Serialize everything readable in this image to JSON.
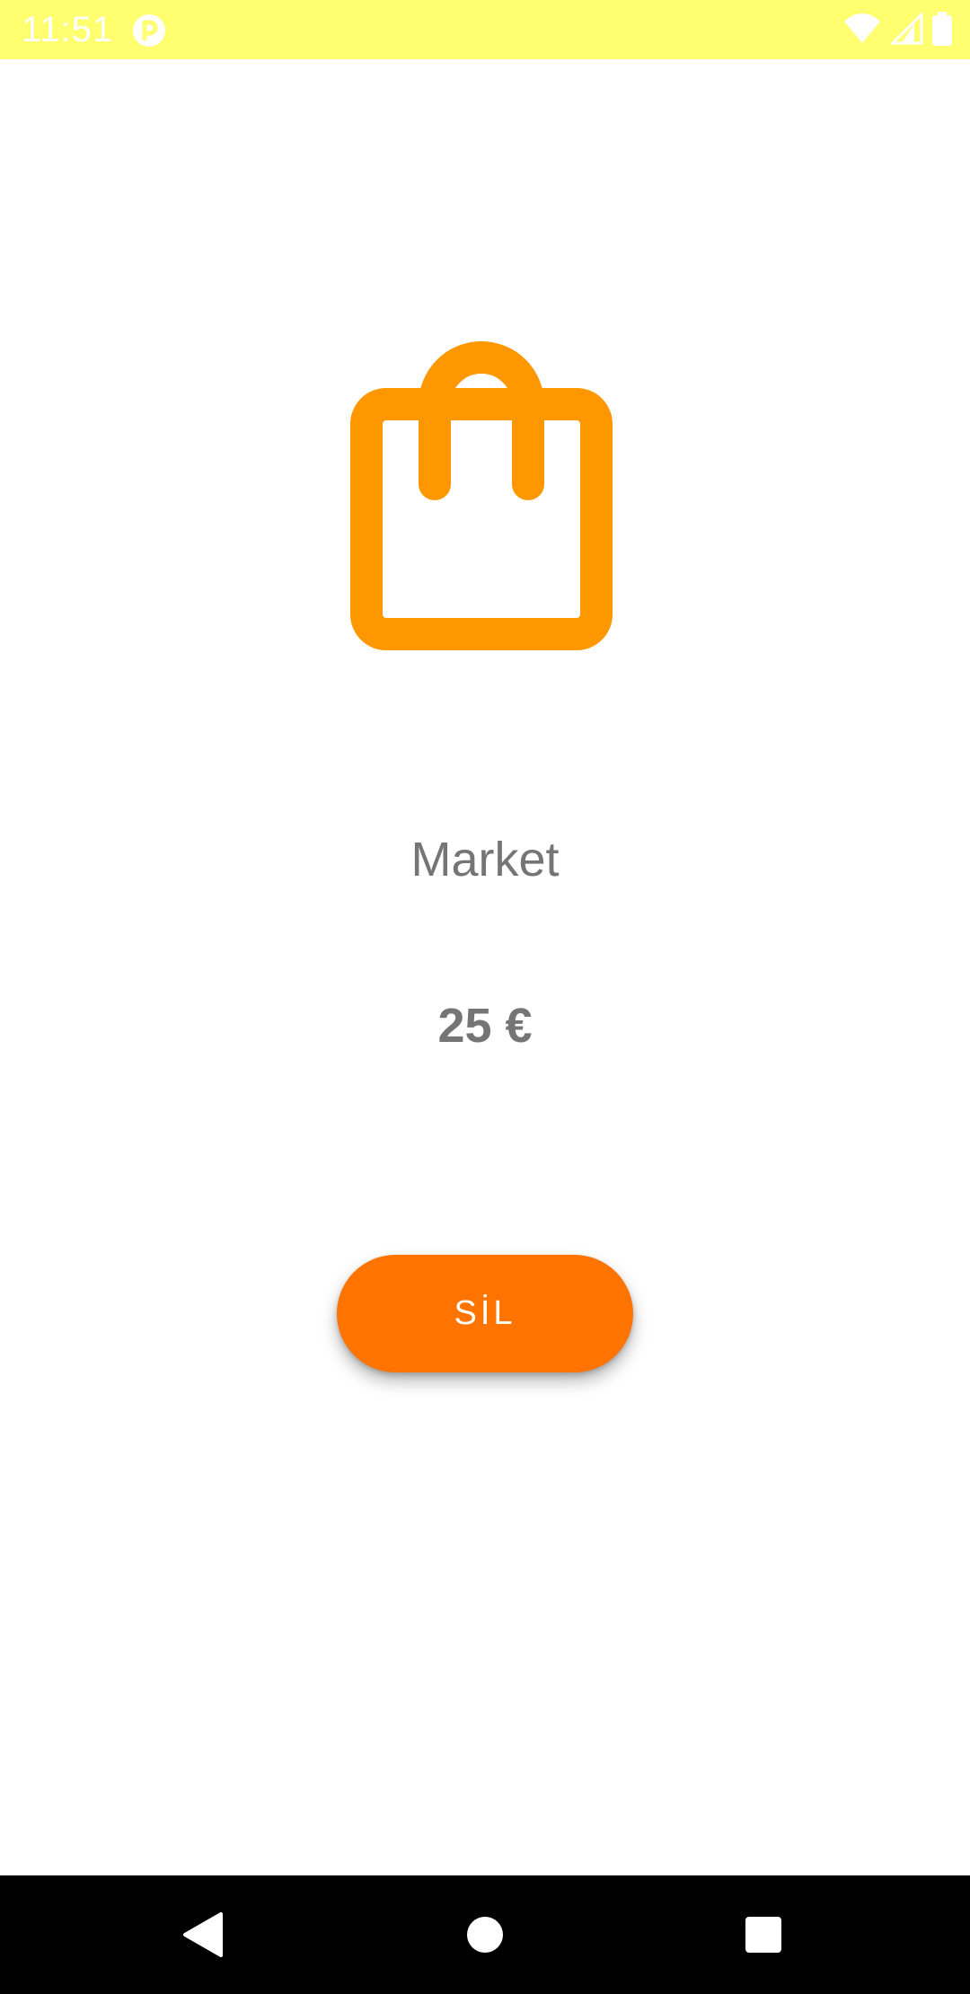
{
  "status_bar": {
    "time": "11:51",
    "background_color": "#ffff70",
    "icons": [
      "app-notification-icon",
      "wifi-icon",
      "cellular-signal-icon",
      "battery-icon"
    ]
  },
  "expense": {
    "icon": "shopping-bag-icon",
    "icon_color": "#ff9800",
    "category": "Market",
    "amount": "25 €"
  },
  "actions": {
    "delete_label": "SİL",
    "delete_color": "#ff7300"
  },
  "navigation_bar": {
    "icons": [
      "back-icon",
      "home-icon",
      "recents-icon"
    ]
  }
}
